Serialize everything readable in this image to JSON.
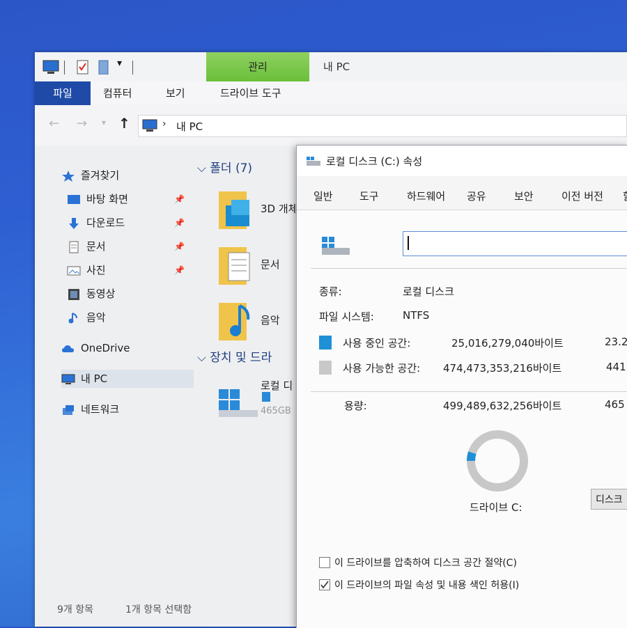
{
  "explorer": {
    "window_title": "내 PC",
    "manage_tab": "관리",
    "ribbon_tabs": [
      "파일",
      "컴퓨터",
      "보기",
      "드라이브 도구"
    ],
    "address": "내 PC",
    "nav": [
      {
        "label": "즐겨찾기",
        "icon": "star-icon"
      },
      {
        "label": "바탕 화면",
        "icon": "desktop-icon"
      },
      {
        "label": "다운로드",
        "icon": "download-icon"
      },
      {
        "label": "문서",
        "icon": "document-icon"
      },
      {
        "label": "사진",
        "icon": "picture-icon"
      },
      {
        "label": "동영상",
        "icon": "video-icon"
      },
      {
        "label": "음악",
        "icon": "music-icon"
      },
      {
        "label": "OneDrive",
        "icon": "cloud-icon"
      },
      {
        "label": "내 PC",
        "icon": "pc-icon"
      },
      {
        "label": "네트워크",
        "icon": "network-icon"
      }
    ],
    "folders_header": "폴더 (7)",
    "folders": [
      "3D 개체",
      "문서",
      "음악"
    ],
    "devices_header": "장치 및 드라",
    "drive_label": "로컬 디",
    "drive_size": "465GB",
    "status": {
      "count": "9개 항목",
      "selected": "1개 항목 선택함"
    }
  },
  "dialog": {
    "title": "로컬 디스크 (C:) 속성",
    "tabs": [
      "일반",
      "도구",
      "하드웨어",
      "공유",
      "보안",
      "이전 버전",
      "할"
    ],
    "type_label": "종류:",
    "type_value": "로컬 디스크",
    "fs_label": "파일 시스템:",
    "fs_value": "NTFS",
    "used_label": "사용 중인 공간:",
    "used_bytes": "25,016,279,040바이트",
    "used_short": "23.2",
    "free_label": "사용 가능한 공간:",
    "free_bytes": "474,473,353,216바이트",
    "free_short": "441",
    "capacity_label": "용량:",
    "capacity_bytes": "499,489,632,256바이트",
    "capacity_short": "465",
    "drive_caption": "드라이브 C:",
    "cleanup_label": "디스크",
    "compress_label": "이 드라이브를 압축하여 디스크 공간 절약(C)",
    "index_label": "이 드라이브의 파일 속성 및 내용 색인 허용(I)",
    "used_fraction": 0.05,
    "colors": {
      "used": "#1e90d6",
      "free": "#c8c8c8"
    }
  }
}
